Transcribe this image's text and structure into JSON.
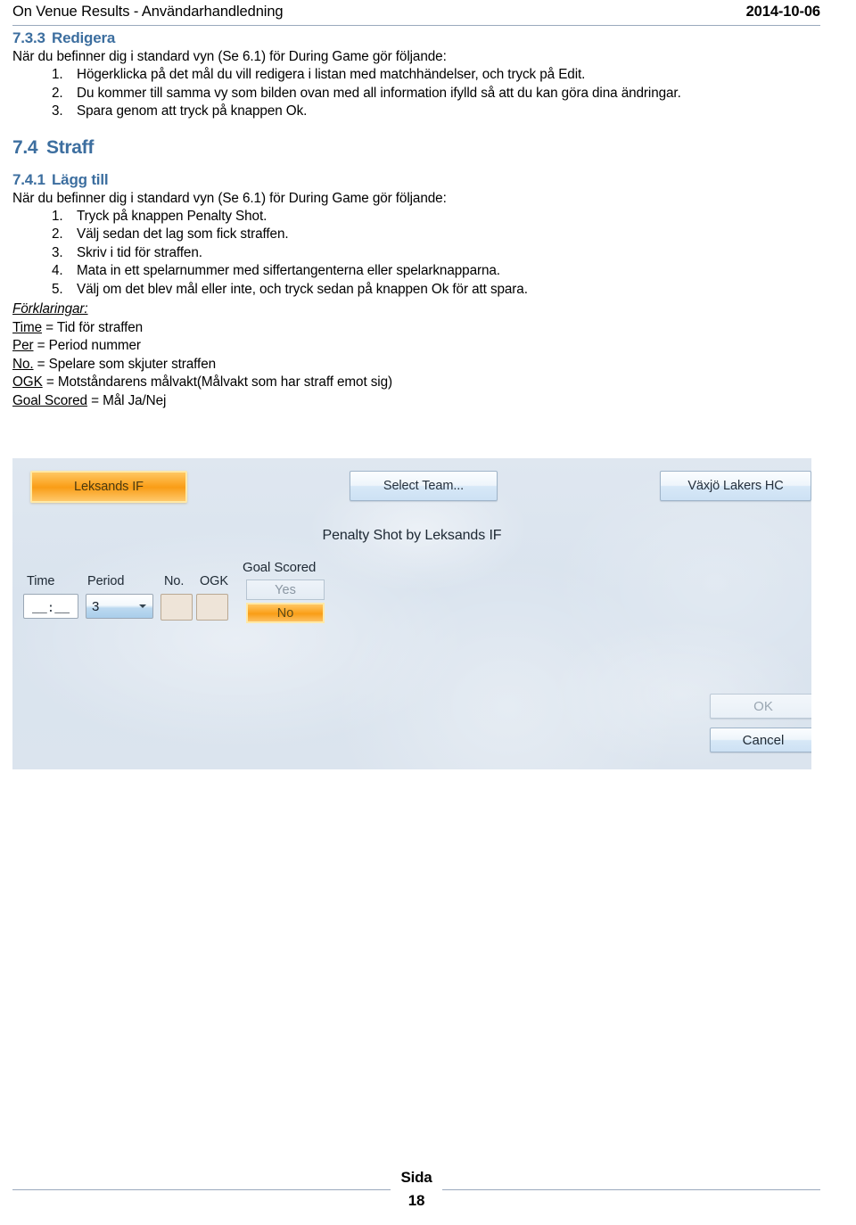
{
  "header": {
    "title": "On Venue Results - Användarhandledning",
    "date": "2014-10-06"
  },
  "sections": {
    "s733": {
      "number": "7.3.3",
      "title": "Redigera",
      "lead": "När du befinner dig i standard vyn (Se 6.1) för During Game gör följande:",
      "steps": [
        "Högerklicka på det mål du vill redigera i listan med matchhändelser, och tryck på Edit.",
        "Du kommer till samma vy som bilden ovan med all information ifylld så att du kan göra dina ändringar.",
        "Spara genom att tryck på knappen Ok."
      ]
    },
    "s74": {
      "number": "7.4",
      "title": "Straff"
    },
    "s741": {
      "number": "7.4.1",
      "title": "Lägg till",
      "lead": "När du befinner dig i standard vyn (Se 6.1) för During Game gör följande:",
      "steps": [
        "Tryck på knappen Penalty Shot.",
        "Välj sedan det lag som fick straffen.",
        "Skriv i tid för straffen.",
        "Mata in ett spelarnummer med siffertangenterna eller spelarknapparna.",
        "Välj om det blev mål eller inte, och tryck sedan på knappen Ok för att spara."
      ]
    }
  },
  "legend": {
    "heading": "Förklaringar:",
    "entries": [
      {
        "term": "Time",
        "definition": " = Tid för straffen"
      },
      {
        "term": "Per",
        "definition": " = Period nummer"
      },
      {
        "term": "No.",
        "definition": " = Spelare som skjuter straffen"
      },
      {
        "term": "OGK",
        "definition": " = Motståndarens målvakt(Målvakt som har straff emot sig)"
      },
      {
        "term": "Goal Scored",
        "definition": " = Mål Ja/Nej"
      }
    ]
  },
  "app_screenshot": {
    "home_team_button": "Leksands IF",
    "select_team_button": "Select Team...",
    "away_team_button": "Växjö Lakers HC",
    "caption": "Penalty Shot by Leksands IF",
    "fields": {
      "time_label": "Time",
      "time_value": "__:__",
      "period_label": "Period",
      "period_value": "3",
      "no_label": "No.",
      "no_value": "",
      "ogk_label": "OGK",
      "ogk_value": "",
      "goal_scored_label": "Goal Scored",
      "goal_yes": "Yes",
      "goal_no": "No"
    },
    "ok_button": "OK",
    "cancel_button": "Cancel",
    "colors": {
      "selected_accent": "#fba524",
      "panel_background": "#dbe4ee",
      "button_face": "#cde1f4"
    }
  },
  "footer": {
    "page_word": "Sida",
    "page_number": "18"
  },
  "theme": {
    "heading_blue": "#3c6e9f",
    "rule_blue": "#9aa9bd"
  }
}
